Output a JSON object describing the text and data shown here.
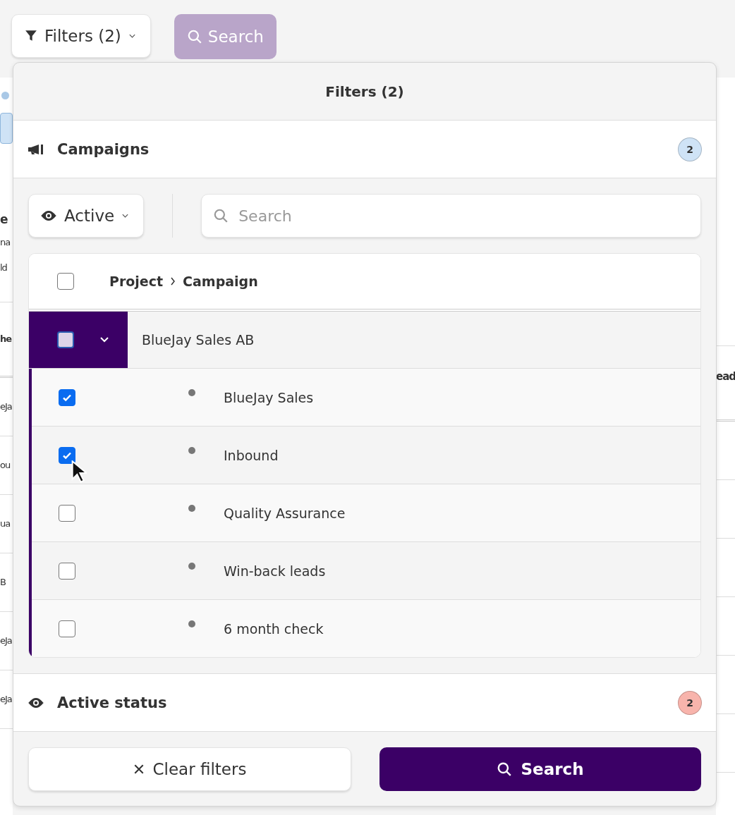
{
  "toolbar": {
    "filters_button": {
      "label": "Filters (2)"
    },
    "search_button": {
      "label": "Search",
      "disabled": true
    }
  },
  "background": {
    "heading": "e",
    "lines": [
      "na",
      "ld"
    ],
    "column_header": "he",
    "right_header": "ead",
    "cells": [
      "eJa",
      "ou",
      "ua",
      "B",
      "eJa",
      "eJa"
    ]
  },
  "popup": {
    "title": "Filters (2)",
    "sections": [
      {
        "kind": "campaigns",
        "label": "Campaigns",
        "count": "2",
        "color": "#cfe3f6"
      }
    ],
    "status_dropdown": {
      "label": "Active"
    },
    "search_field": {
      "placeholder": "Search"
    },
    "table": {
      "header_checked": false,
      "header_project": "Project",
      "header_campaign": "Campaign",
      "groups": [
        {
          "name": "BlueJay Sales AB",
          "checked": false,
          "indeterminate": true,
          "expanded": true,
          "selected": true,
          "children": [
            {
              "name": "BlueJay Sales",
              "checked": true
            },
            {
              "name": "Inbound",
              "checked": true
            },
            {
              "name": "Quality Assurance",
              "checked": false
            },
            {
              "name": "Win-back leads",
              "checked": false
            },
            {
              "name": "6 month check",
              "checked": false
            }
          ]
        }
      ]
    },
    "lower_sections": [
      {
        "kind": "status",
        "label": "Active status",
        "count": "2",
        "color": "#f8b4ac"
      }
    ],
    "clear_button": {
      "label": "Clear filters"
    },
    "search_button": {
      "label": "Search"
    }
  }
}
